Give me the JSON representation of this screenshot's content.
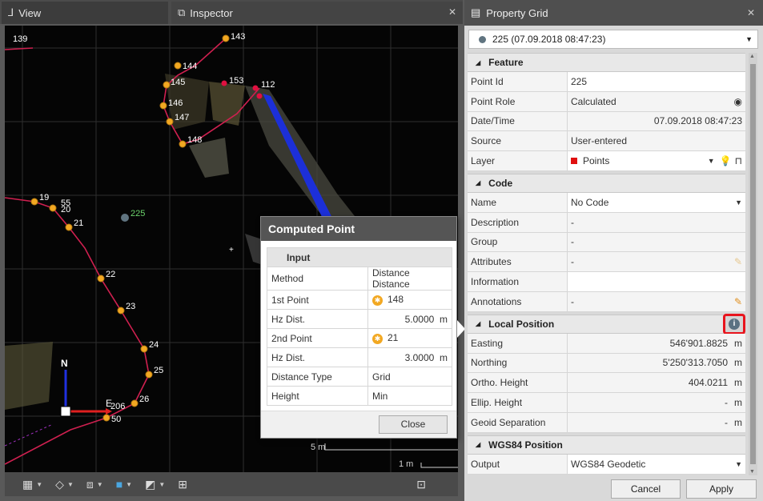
{
  "tabs": {
    "view": "View",
    "inspector": "Inspector"
  },
  "map": {
    "point_labels": [
      "139",
      "143",
      "144",
      "145",
      "153",
      "112",
      "146",
      "147",
      "148",
      "19",
      "55",
      "20",
      "21",
      "225",
      "22",
      "23",
      "24",
      "25",
      "26",
      "206",
      "50"
    ],
    "north_label": "N",
    "east_label": "E",
    "scale_5m": "5 m",
    "scale_1m": "1 m"
  },
  "popup": {
    "title": "Computed Point",
    "section": "Input",
    "rows": [
      {
        "label": "Method",
        "value": "Distance Distance",
        "unit": ""
      },
      {
        "label": "1st Point",
        "value": "148",
        "unit": ""
      },
      {
        "label": "Hz Dist.",
        "value": "5.0000",
        "unit": "m"
      },
      {
        "label": "2nd Point",
        "value": "21",
        "unit": ""
      },
      {
        "label": "Hz Dist.",
        "value": "3.0000",
        "unit": "m"
      },
      {
        "label": "Distance Type",
        "value": "Grid",
        "unit": ""
      },
      {
        "label": "Height",
        "value": "Min",
        "unit": ""
      }
    ],
    "close_label": "Close"
  },
  "property_grid": {
    "title": "Property Grid",
    "selected": "225 (07.09.2018 08:47:23)",
    "feature": {
      "header": "Feature",
      "point_id_label": "Point Id",
      "point_id": "225",
      "point_role_label": "Point Role",
      "point_role": "Calculated",
      "datetime_label": "Date/Time",
      "datetime": "07.09.2018 08:47:23",
      "source_label": "Source",
      "source": "User-entered",
      "layer_label": "Layer",
      "layer": "Points"
    },
    "code": {
      "header": "Code",
      "name_label": "Name",
      "name": "No Code",
      "description_label": "Description",
      "description": "-",
      "group_label": "Group",
      "group": "-",
      "attributes_label": "Attributes",
      "attributes": "-",
      "information_label": "Information",
      "information": "",
      "annotations_label": "Annotations",
      "annotations": "-"
    },
    "local_position": {
      "header": "Local Position",
      "easting_label": "Easting",
      "easting": "546'901.8825",
      "northing_label": "Northing",
      "northing": "5'250'313.7050",
      "ortho_label": "Ortho. Height",
      "ortho": "404.0211",
      "ellip_label": "Ellip. Height",
      "ellip": "-",
      "geoid_label": "Geoid Separation",
      "geoid": "-",
      "unit": "m"
    },
    "wgs84": {
      "header": "WGS84 Position",
      "output_label": "Output",
      "output": "WGS84 Geodetic"
    },
    "cancel_label": "Cancel",
    "apply_label": "Apply"
  },
  "colors": {
    "accent_red": "#e8141d",
    "point_orange": "#f2a822",
    "calc_point": "#607480"
  }
}
